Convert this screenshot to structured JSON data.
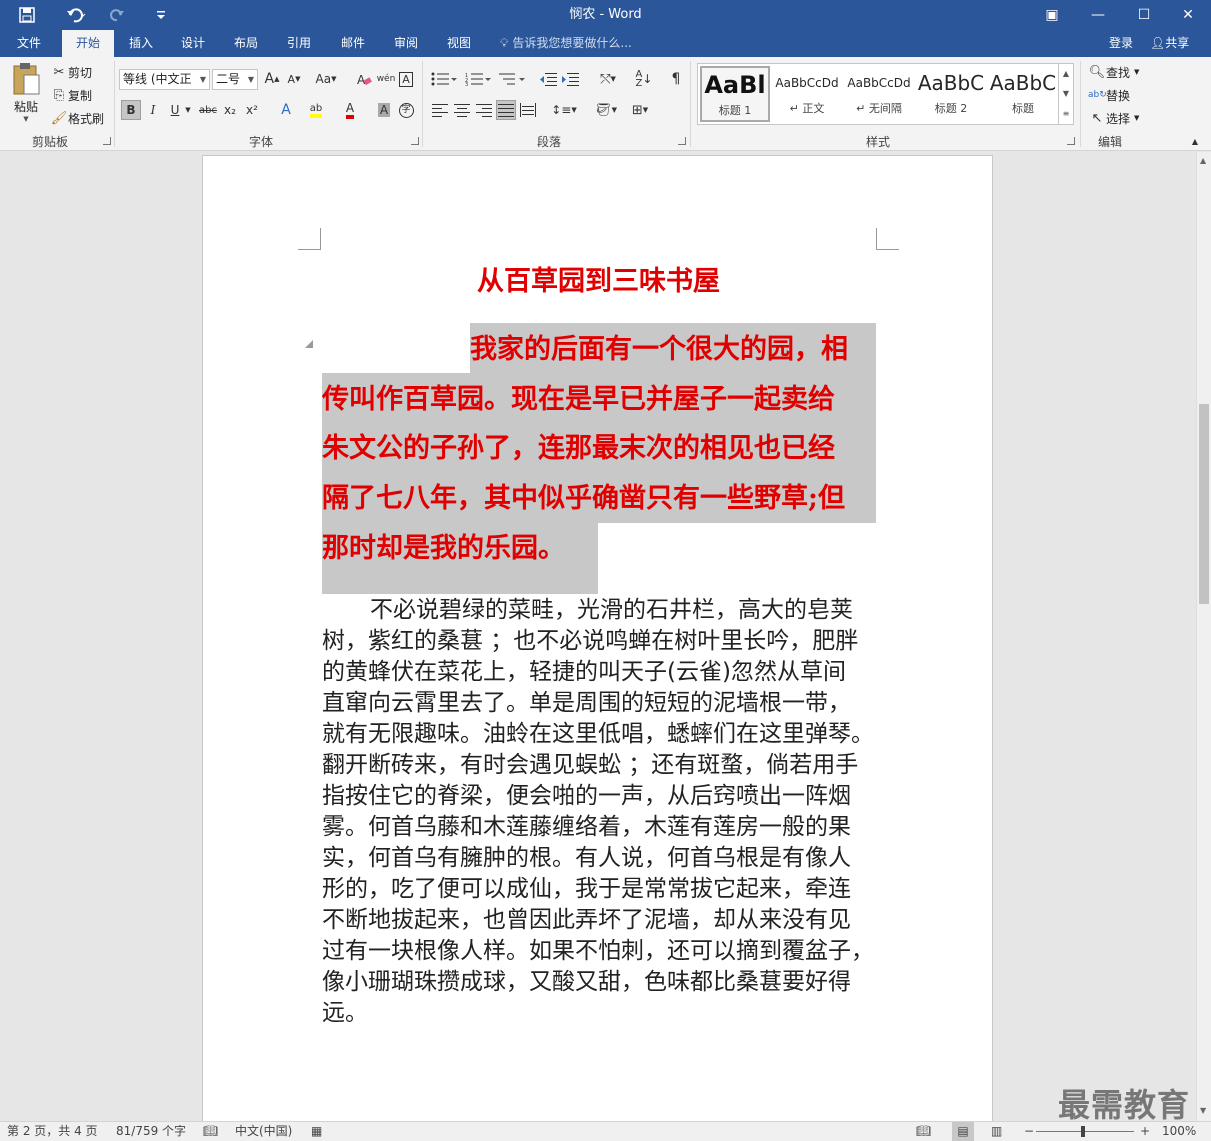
{
  "app": {
    "title": "悯农 - Word",
    "title_bar_color": "#2b579a",
    "window_buttons": {
      "ribbon_display": "▣",
      "minimize": "—",
      "maximize": "☐",
      "close": "✕"
    }
  },
  "quick_access": {
    "save_icon": "save-icon",
    "undo_icon": "undo-icon",
    "redo_icon": "redo-icon",
    "customize_icon": "customize-icon"
  },
  "tabs": [
    {
      "label": "文件"
    },
    {
      "label": "开始"
    },
    {
      "label": "插入"
    },
    {
      "label": "设计"
    },
    {
      "label": "布局"
    },
    {
      "label": "引用"
    },
    {
      "label": "邮件"
    },
    {
      "label": "审阅"
    },
    {
      "label": "视图"
    }
  ],
  "active_tab": "开始",
  "tell_me": "告诉我您想要做什么...",
  "login": "登录",
  "share": "共享",
  "clipboard": {
    "paste": "粘贴",
    "cut": "剪切",
    "copy": "复制",
    "format_painter": "格式刷",
    "label": "剪贴板"
  },
  "font": {
    "family": "等线 (中文正",
    "size": "二号",
    "grow": "A",
    "shrink": "A",
    "case": "Aa",
    "label": "字体",
    "bold": "B",
    "italic": "I",
    "underline": "U",
    "strike": "abc",
    "subscript": "x₂",
    "superscript": "x²",
    "effects": "A",
    "highlight": "ab",
    "color": "A",
    "char_shade": "A",
    "enclose": "字"
  },
  "paragraph": {
    "label": "段落"
  },
  "styles": {
    "label": "样式",
    "items": [
      {
        "preview": "AaBl",
        "name": "标题 1"
      },
      {
        "preview": "AaBbCcDd",
        "name": "正文"
      },
      {
        "preview": "AaBbCcDd",
        "name": "无间隔"
      },
      {
        "preview": "AaBbC",
        "name": "标题 2"
      },
      {
        "preview": "AaBbC",
        "name": "标题"
      }
    ]
  },
  "editing": {
    "find": "查找",
    "replace": "替换",
    "select": "选择",
    "label": "编辑"
  },
  "document": {
    "heading": "从百草园到三味书屋",
    "highlight_lines": [
      "我家的后面有一个很大的园，相",
      "传叫作百草园。现在是早已并屋子一起卖给",
      "朱文公的子孙了，连那最末次的相见也已经",
      "隔了七八年，其中似乎确凿只有一些野草;但",
      "那时却是我的乐园。"
    ],
    "body_lines": [
      "不必说碧绿的菜畦，光滑的石井栏，高大的皂荚",
      "树，紫红的桑葚 ；也不必说鸣蝉在树叶里长吟，肥胖",
      "的黄蜂伏在菜花上，轻捷的叫天子(云雀)忽然从草间",
      "直窜向云霄里去了。单是周围的短短的泥墙根一带，",
      "就有无限趣味。油蛉在这里低唱，蟋蟀们在这里弹琴。",
      "翻开断砖来，有时会遇见蜈蚣 ；还有斑蝥，倘若用手",
      "指按住它的脊梁，便会啪的一声，从后窍喷出一阵烟",
      "雾。何首乌藤和木莲藤缠络着，木莲有莲房一般的果",
      "实，何首乌有臃肿的根。有人说，何首乌根是有像人",
      "形的，吃了便可以成仙，我于是常常拔它起来，牵连",
      "不断地拔起来，也曾因此弄坏了泥墙，却从来没有见",
      "过有一块根像人样。如果不怕刺，还可以摘到覆盆子，",
      "像小珊瑚珠攒成球，又酸又甜，色味都比桑葚要好得",
      "远。"
    ],
    "heading_color": "#e00000",
    "highlight_color": "#c8c8c8"
  },
  "status": {
    "page": "第 2 页，共 4 页",
    "words": "81/759 个字",
    "language": "中文(中国)",
    "zoom": "100%",
    "zoom_minus": "−",
    "zoom_plus": "+"
  },
  "watermark": "最需教育"
}
